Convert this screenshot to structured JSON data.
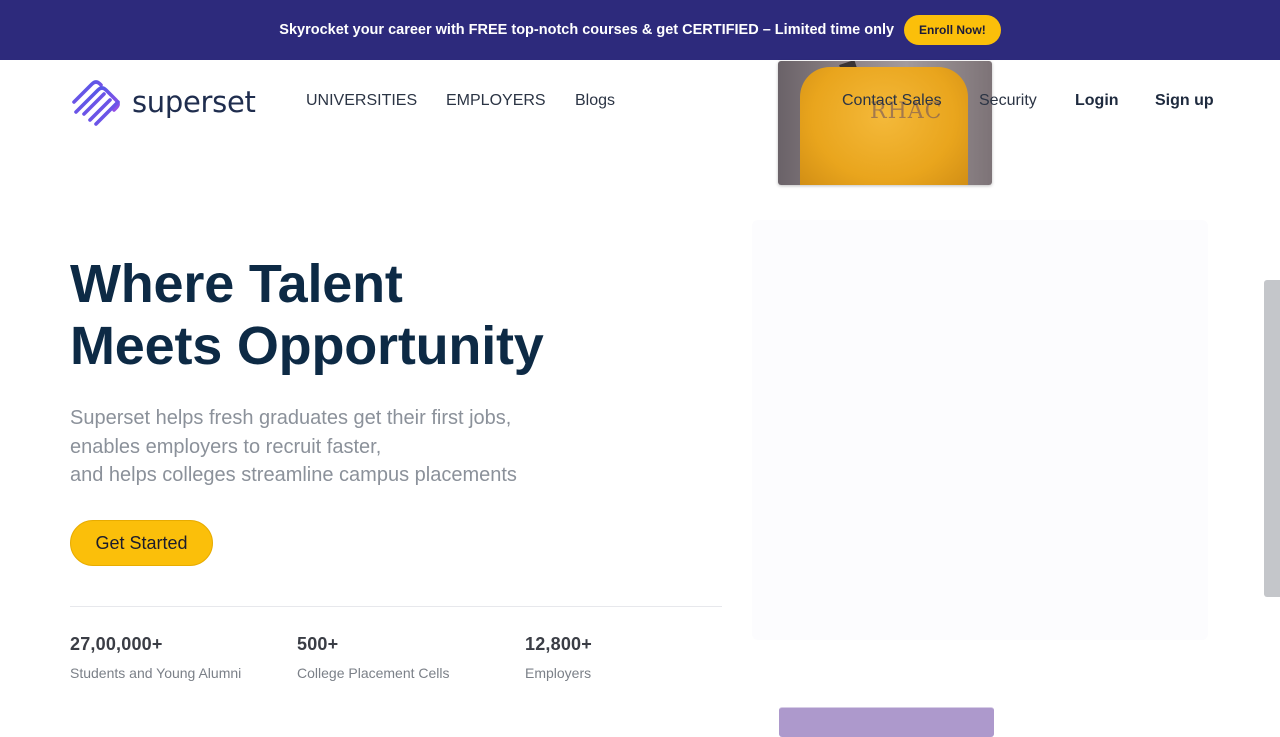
{
  "banner": {
    "text": "Skyrocket your career with FREE top-notch courses & get CERTIFIED – Limited time only",
    "button": "Enroll Now!"
  },
  "logo": {
    "name": "superset",
    "icon": "superset-logo-icon"
  },
  "nav": {
    "universities": "UNIVERSITIES",
    "employers": "EMPLOYERS",
    "blogs": "Blogs",
    "contact_sales": "Contact Sales",
    "security": "Security",
    "login": "Login",
    "signup": "Sign up"
  },
  "hero": {
    "title_line1": "Where Talent",
    "title_line2": "Meets Opportunity",
    "desc_line1": "Superset helps fresh graduates get their first jobs,",
    "desc_line2": "enables employers to recruit faster,",
    "desc_line3": "and helps colleges streamline campus placements",
    "cta": "Get Started"
  },
  "stats": [
    {
      "value": "27,00,000+",
      "label": "Students and Young Alumni"
    },
    {
      "value": "500+",
      "label": "College Placement Cells"
    },
    {
      "value": "12,800+",
      "label": "Employers"
    }
  ],
  "media": {
    "photo_print_text": "RHAC"
  },
  "colors": {
    "banner_bg": "#2d2a7c",
    "accent_yellow": "#fbbf0a",
    "title_navy": "#0d2a45",
    "logo_gradient_start": "#3b5be8",
    "logo_gradient_end": "#9a4ee6"
  }
}
